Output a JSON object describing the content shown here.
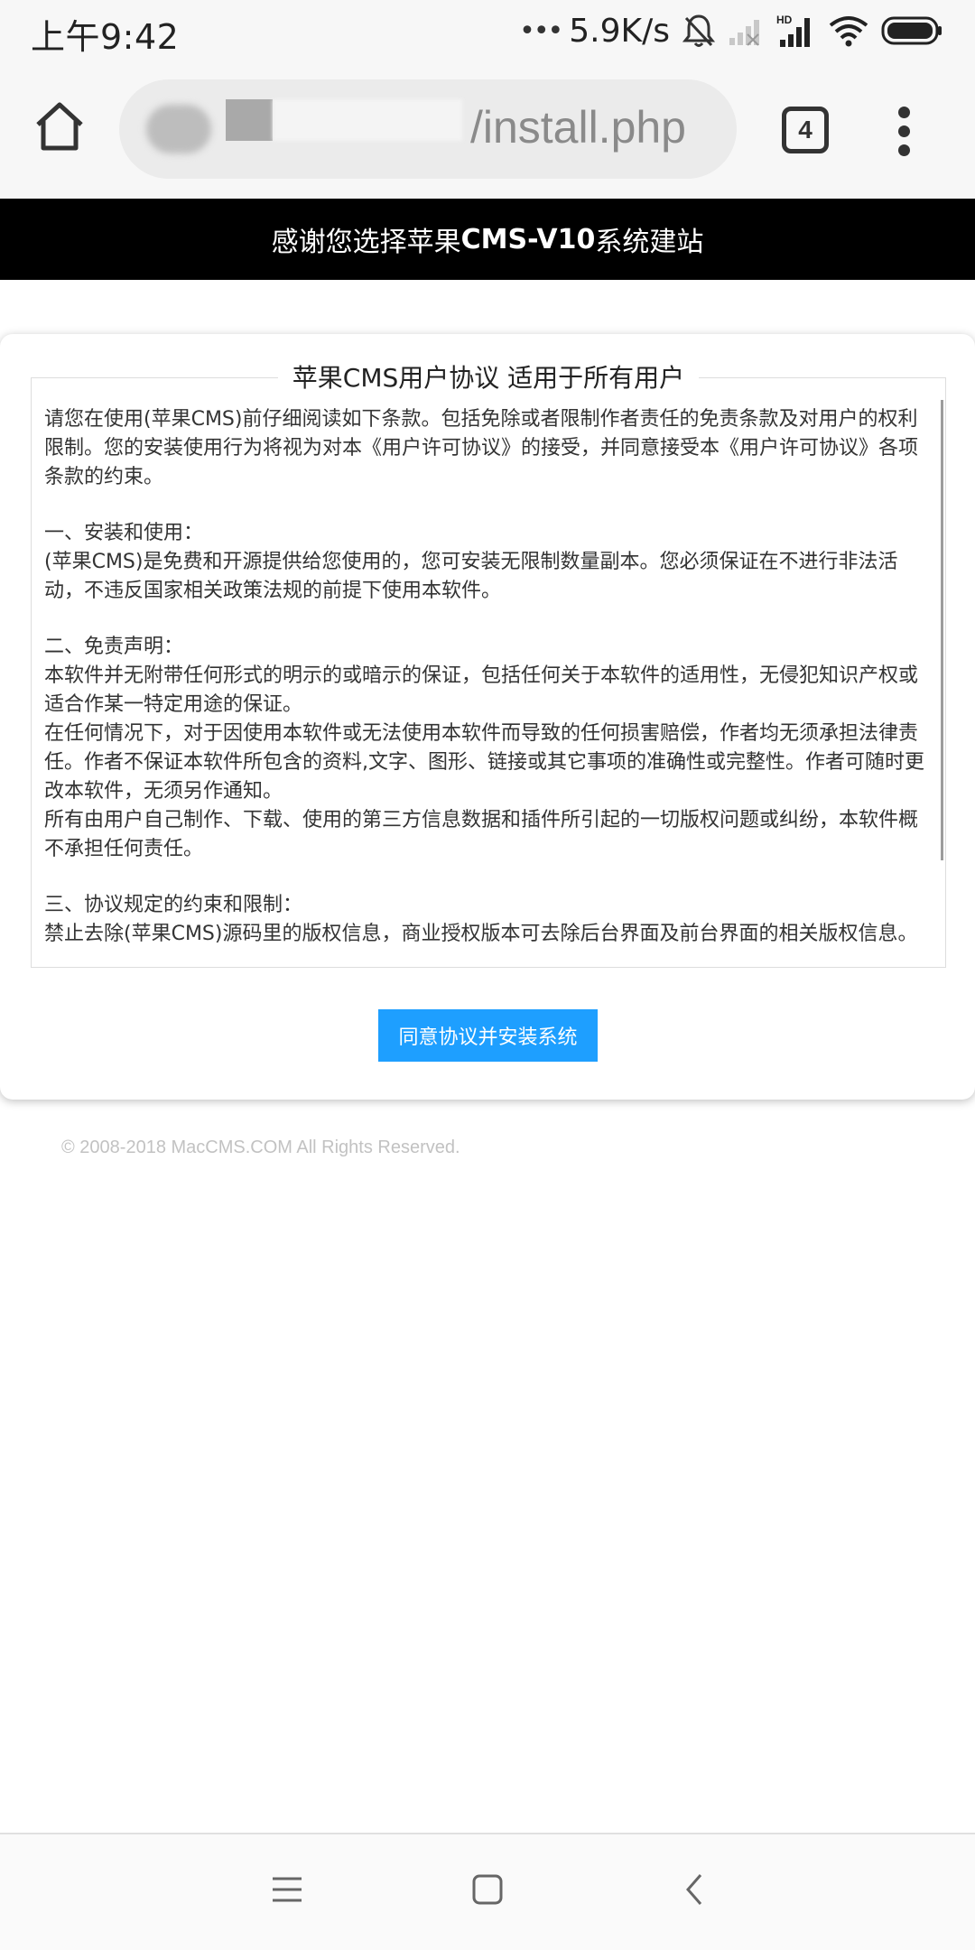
{
  "status_bar": {
    "time": "上午9:42",
    "dots": "•••",
    "net_speed": "5.9K/s"
  },
  "browser": {
    "url_visible": "/install.php",
    "tab_count": "4"
  },
  "page": {
    "header_prefix": "感谢您选择苹果",
    "header_bold": "CMS-V10",
    "header_suffix": "系统建站",
    "legend": "苹果CMS用户协议 适用于所有用户",
    "agreement": [
      "请您在使用(苹果CMS)前仔细阅读如下条款。包括免除或者限制作者责任的免责条款及对用户的权利限制。您的安装使用行为将视为对本《用户许可协议》的接受，并同意接受本《用户许可协议》各项条款的约束。",
      "",
      "一、安装和使用：",
      "(苹果CMS)是免费和开源提供给您使用的，您可安装无限制数量副本。您必须保证在不进行非法活动，不违反国家相关政策法规的前提下使用本软件。",
      "",
      "二、免责声明：",
      "本软件并无附带任何形式的明示的或暗示的保证，包括任何关于本软件的适用性，无侵犯知识产权或适合作某一特定用途的保证。",
      "在任何情况下，对于因使用本软件或无法使用本软件而导致的任何损害赔偿，作者均无须承担法律责任。作者不保证本软件所包含的资料,文字、图形、链接或其它事项的准确性或完整性。作者可随时更改本软件，无须另作通知。",
      "所有由用户自己制作、下载、使用的第三方信息数据和插件所引起的一切版权问题或纠纷，本软件概不承担任何责任。",
      "",
      "三、协议规定的约束和限制：",
      "禁止去除(苹果CMS)源码里的版权信息，商业授权版本可去除后台界面及前台界面的相关版权信息。"
    ],
    "agree_button": "同意协议并安装系统",
    "copyright": "© 2008-2018 MacCMS.COM All Rights Reserved."
  },
  "colors": {
    "header_bg": "#000000",
    "button_bg": "#1e9fff"
  }
}
